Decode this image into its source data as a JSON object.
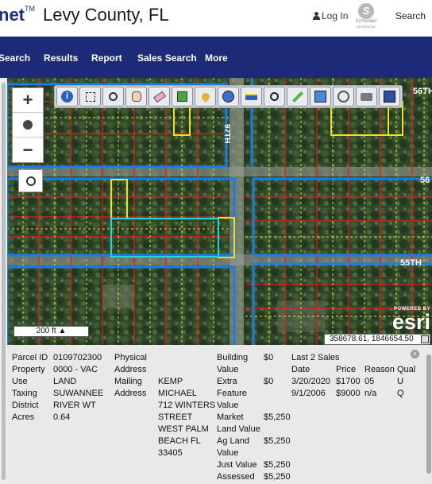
{
  "header": {
    "logo_text": "net",
    "logo_mark": "TM",
    "county": "Levy County, FL",
    "login": "Log In",
    "schneider_name": "Schneider",
    "schneider_sub": "GEOSPATIAL",
    "search": "Search"
  },
  "nav": {
    "items": [
      "Search",
      "Results",
      "Report",
      "Sales Search",
      "More"
    ]
  },
  "map": {
    "road_labels": [
      "56TH",
      "56",
      "55TH",
      "97TH"
    ],
    "zoom_in": "+",
    "zoom_out": "−",
    "scale": "200 ft",
    "esri_powered": "POWERED BY",
    "esri_name": "esri",
    "coords": "358678.61, 1846654.50",
    "toolbar_icons": [
      "info-icon",
      "select-icon",
      "zoom-in-icon",
      "pan-icon",
      "eraser-icon",
      "select-parcels-icon",
      "pushpin-icon",
      "layers-icon",
      "measure-icon",
      "zoom-icon",
      "draw-icon",
      "print-preview-icon",
      "buffer-icon",
      "print-icon",
      "save-icon"
    ]
  },
  "parcel": {
    "parcel_id_label": "Parcel ID",
    "parcel_id": "0109702300",
    "property_use_label_1": "Property",
    "property_use_label_2": "Use",
    "property_use_1": "0000 - VAC",
    "property_use_2": "LAND",
    "taxing_label_1": "Taxing",
    "taxing_label_2": "District",
    "taxing_1": "SUWANNEE",
    "taxing_2": "RIVER WT",
    "acres_label": "Acres",
    "acres": "0.64",
    "physical_label_1": "Physical",
    "physical_label_2": "Address",
    "mailing_label_1": "Mailing",
    "mailing_label_2": "Address",
    "mailing_lines": [
      "KEMP",
      "MICHAEL",
      "712 WINTERS",
      "STREET",
      "WEST PALM",
      "BEACH FL",
      "33405"
    ],
    "building_label_1": "Building",
    "building_label_2": "Value",
    "building_value": "$0",
    "extra_label_1": "Extra",
    "extra_label_2": "Feature",
    "extra_label_3": "Value",
    "extra_value": "$0",
    "market_label_1": "Market",
    "market_label_2": "Land Value",
    "market_value": "$5,250",
    "ag_label_1": "Ag Land",
    "ag_label_2": "Value",
    "ag_value": "$5,250",
    "just_label": "Just Value",
    "just_value": "$5,250",
    "assessed_label": "Assessed",
    "assessed_value": "$5,250",
    "sales_title": "Last 2 Sales",
    "sales_headers": [
      "Date",
      "Price",
      "Reason",
      "Qual"
    ],
    "sales": [
      {
        "date": "3/20/2020",
        "price": "$1700",
        "reason": "05",
        "qual": "U"
      },
      {
        "date": "9/1/2006",
        "price": "$9000",
        "reason": "n/a",
        "qual": "Q"
      }
    ],
    "close": "×"
  }
}
